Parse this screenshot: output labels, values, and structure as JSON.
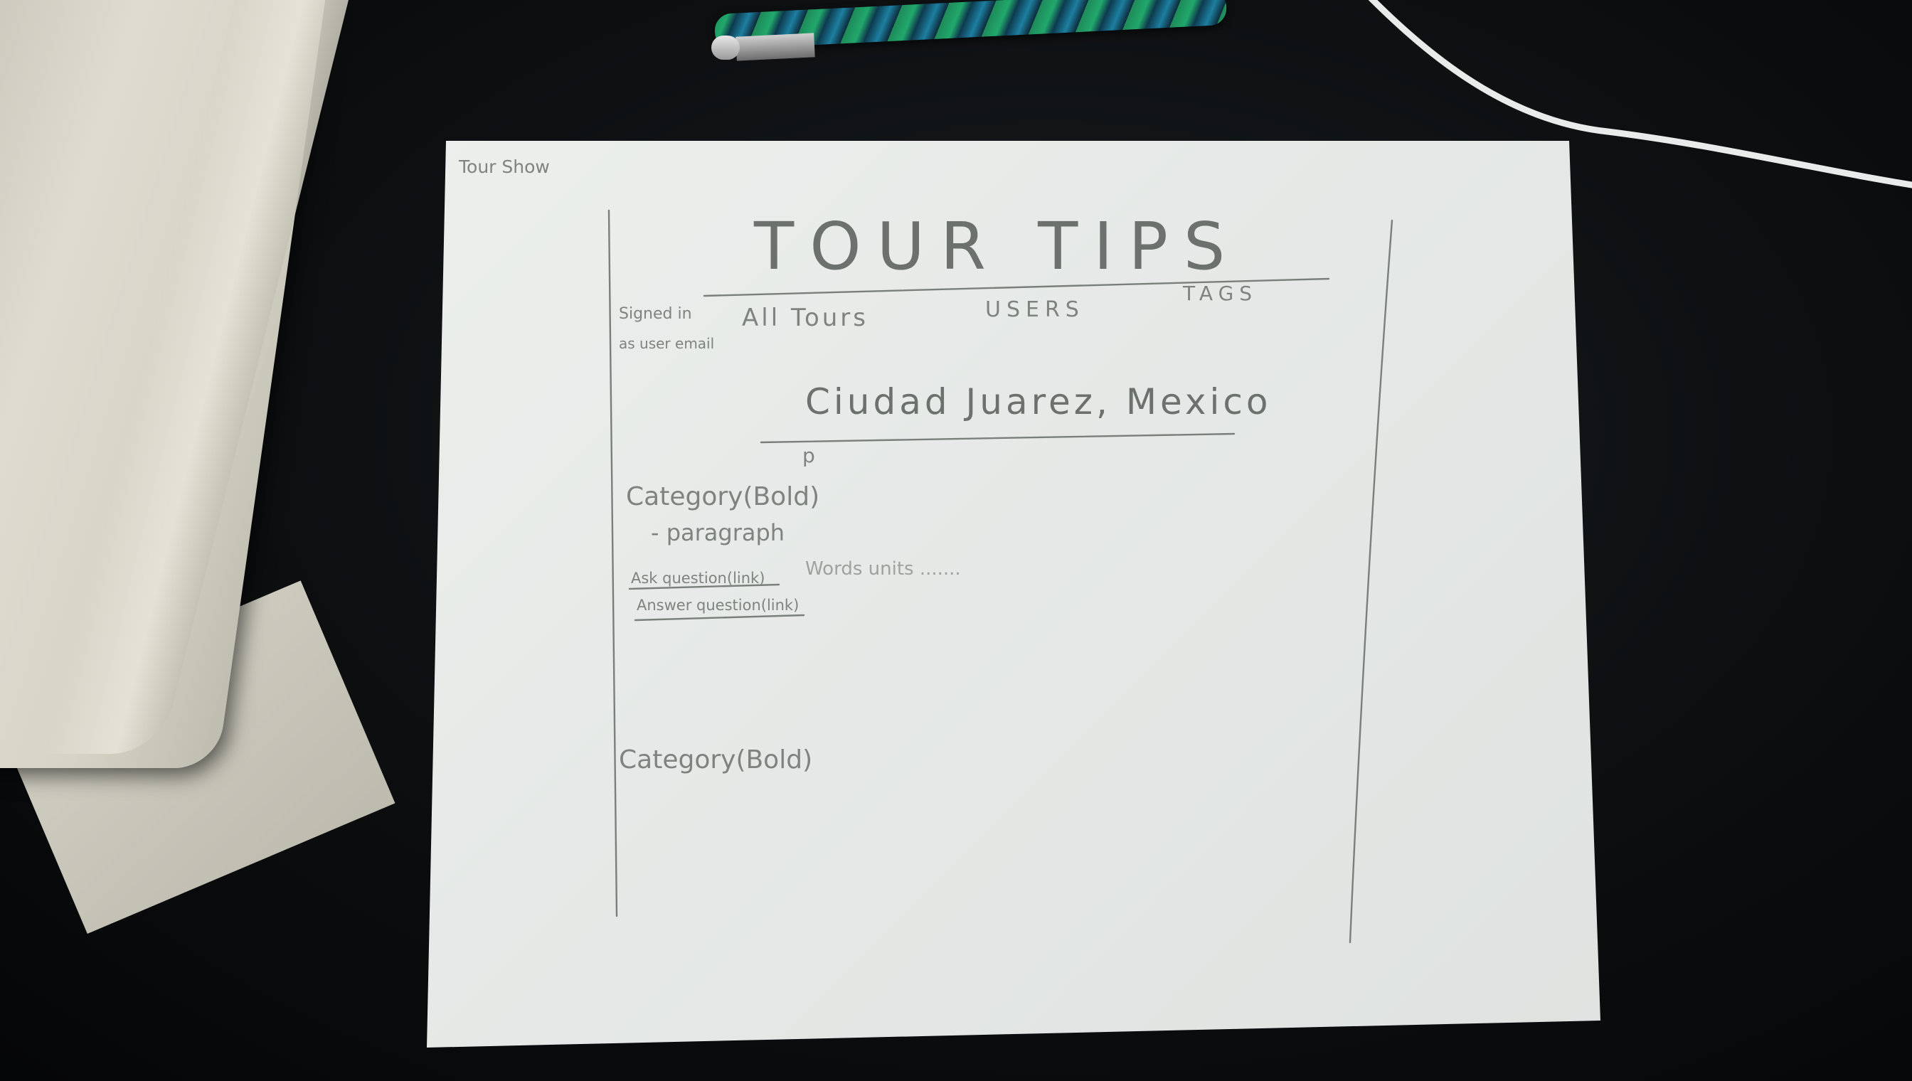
{
  "corner_label": "Tour Show",
  "sketch": {
    "title": "TOUR TIPS",
    "nav": {
      "all_tours": "All Tours",
      "users": "USERS",
      "tags": "TAGS"
    },
    "sign_in_note_line1": "Signed in",
    "sign_in_note_line2": "as user email",
    "location": "Ciudad Juarez, Mexico",
    "p_mark": "p",
    "category_1": "Category(Bold)",
    "paragraph": "- paragraph",
    "ask_question": "Ask question(link)",
    "words_note": "Words units .......",
    "answer_question": "Answer question(link)",
    "category_2": "Category(Bold)"
  }
}
